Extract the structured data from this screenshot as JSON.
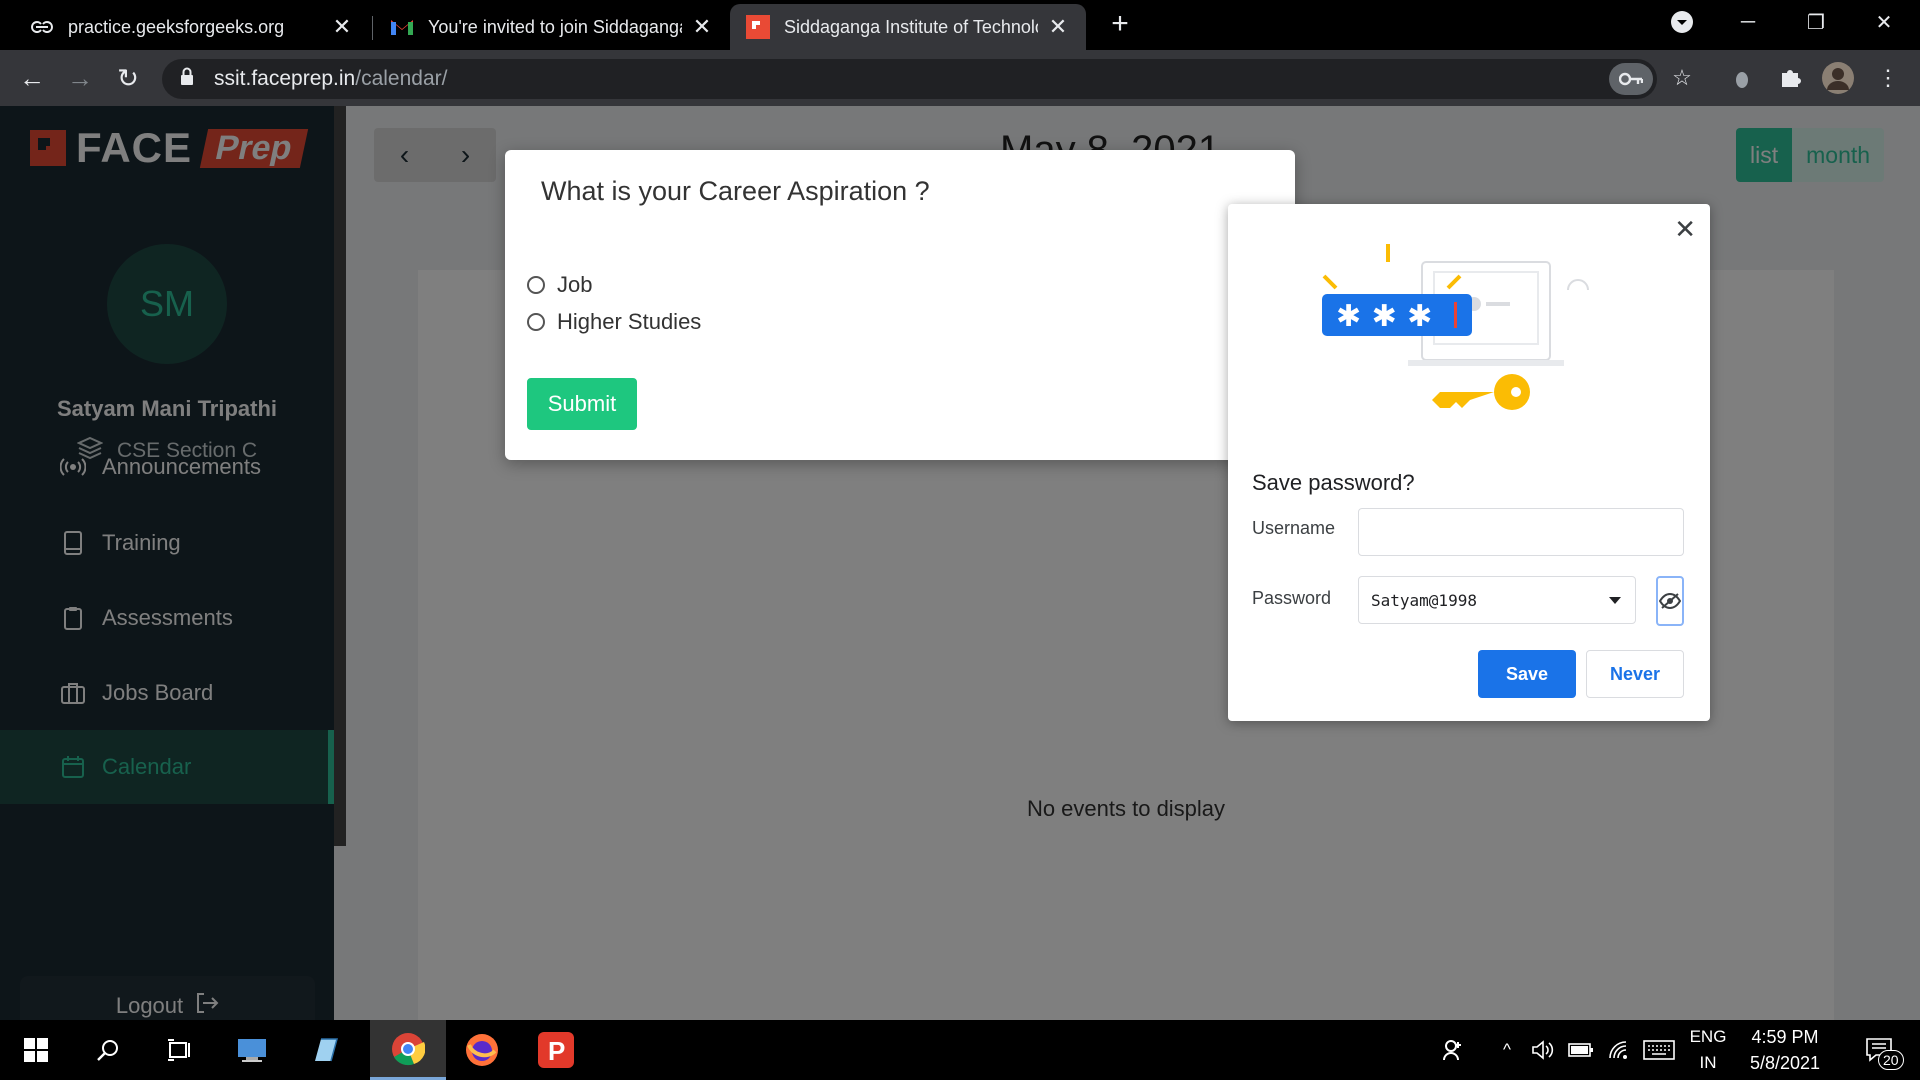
{
  "browser": {
    "tabs": [
      {
        "title": "practice.geeksforgeeks.org",
        "favicon": "geeksforgeeks-icon",
        "active": false
      },
      {
        "title": "You're invited to join Siddaganga",
        "favicon": "gmail-icon",
        "active": false
      },
      {
        "title": "Siddaganga Institute of Technolo",
        "favicon": "faceprep-icon",
        "active": true
      }
    ],
    "new_tab": "+",
    "url_host": "ssit.faceprep.in",
    "url_path": "/calendar/"
  },
  "sidebar": {
    "logo_face": "FACE",
    "logo_prep": "Prep",
    "avatar_initials": "SM",
    "user_name": "Satyam Mani Tripathi",
    "user_section": "CSE Section C",
    "items": [
      {
        "label": "Announcements",
        "icon": "broadcast-icon"
      },
      {
        "label": "Training",
        "icon": "book-icon"
      },
      {
        "label": "Assessments",
        "icon": "clipboard-icon"
      },
      {
        "label": "Jobs Board",
        "icon": "briefcase-icon"
      },
      {
        "label": "Calendar",
        "icon": "calendar-icon",
        "active": true
      }
    ],
    "logout": "Logout"
  },
  "calendar": {
    "title": "May 8, 2021",
    "view_list": "list",
    "view_month": "month",
    "empty_text": "No events to display"
  },
  "career_modal": {
    "question": "What is your Career Aspiration ?",
    "options": [
      "Job",
      "Higher Studies"
    ],
    "submit": "Submit"
  },
  "password_bubble": {
    "title": "Save password?",
    "username_label": "Username",
    "username_value": "",
    "password_label": "Password",
    "password_value": "Satyam@1998",
    "save": "Save",
    "never": "Never"
  },
  "taskbar": {
    "lang_top": "ENG",
    "lang_bottom": "IN",
    "time": "4:59 PM",
    "date": "5/8/2021",
    "notification_count": "20"
  },
  "colors": {
    "accent_green": "#2fc29a",
    "submit_green": "#1ec77f",
    "chrome_blue": "#1a73e8",
    "sidebar_bg": "#1b2b32"
  }
}
